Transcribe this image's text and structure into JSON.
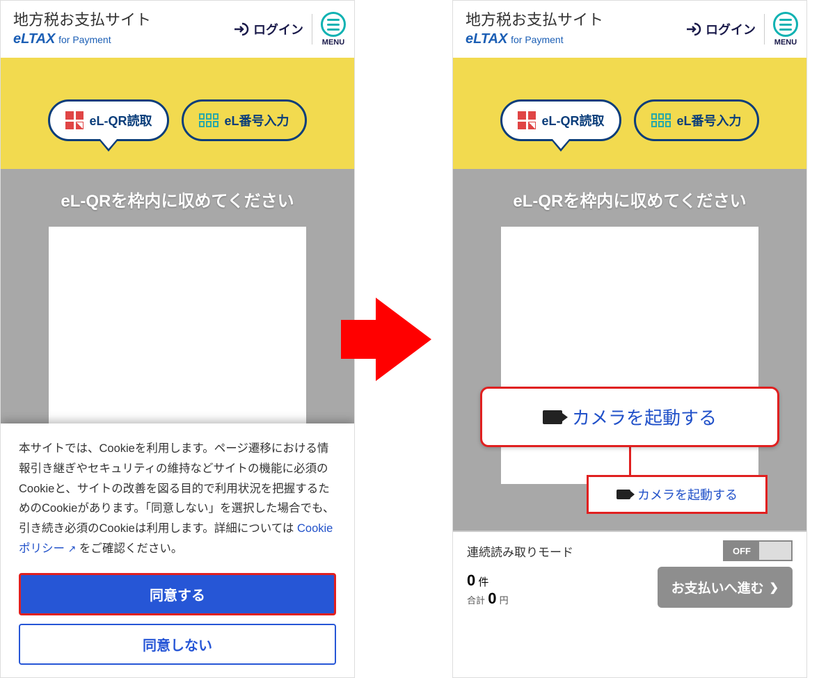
{
  "header": {
    "site_title": "地方税お支払サイト",
    "logo_el": "eLTAX",
    "logo_fp": "for Payment",
    "login_label": "ログイン",
    "menu_label": "MENU"
  },
  "tabs": {
    "qr_label": "eL-QR読取",
    "num_label": "eL番号入力"
  },
  "scan": {
    "instruction": "eL-QRを枠内に収めてください",
    "launch_label": "カメラを起動する"
  },
  "controls": {
    "toggle_label": "連続読み取りモード",
    "toggle_state": "OFF",
    "count_value": "0",
    "count_unit": "件",
    "total_label": "合計",
    "total_value": "0",
    "total_unit": "円",
    "proceed_label": "お支払いへ進む"
  },
  "cookie": {
    "text_before": "本サイトでは、Cookieを利用します。ページ遷移における情報引き継ぎやセキュリティの維持などサイトの機能に必須のCookieと、サイトの改善を図る目的で利用状況を把握するためのCookieがあります。「同意しない」を選択した場合でも、引き続き必須のCookieは利用します。詳細については ",
    "policy_link": "Cookieポリシー",
    "text_after": " をご確認ください。",
    "agree": "同意する",
    "disagree": "同意しない"
  }
}
